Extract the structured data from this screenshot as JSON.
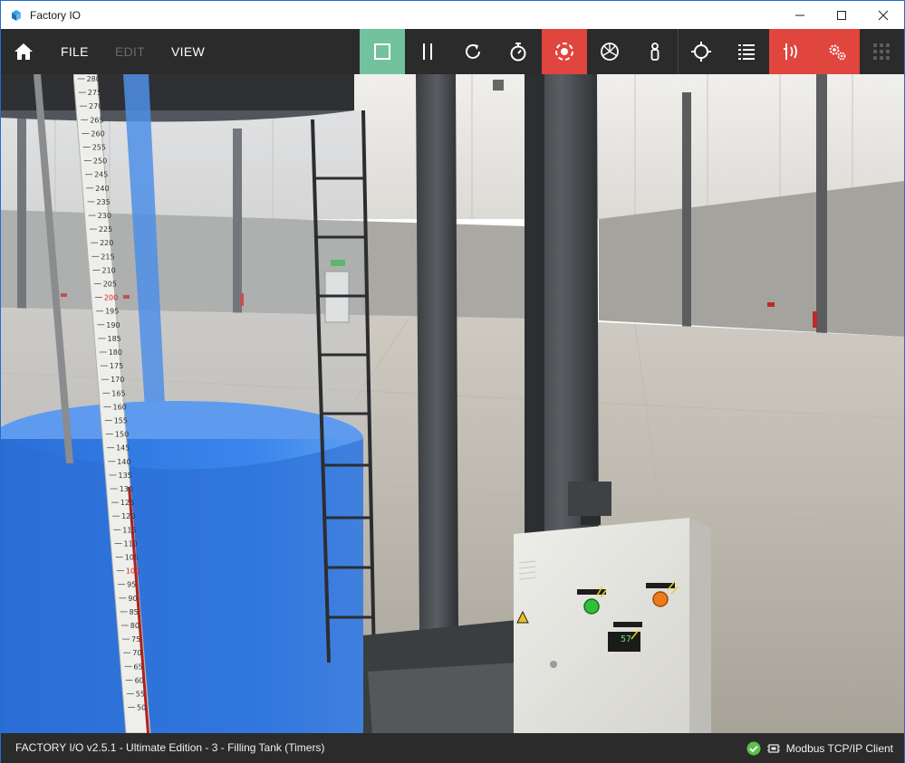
{
  "window": {
    "title": "Factory IO"
  },
  "toolbar": {
    "menu": [
      {
        "label": "FILE",
        "enabled": true
      },
      {
        "label": "EDIT",
        "enabled": false
      },
      {
        "label": "VIEW",
        "enabled": true
      }
    ],
    "buttons": [
      {
        "name": "play-stop",
        "icon": "stop-square-icon",
        "active": true,
        "color": "#72c29d"
      },
      {
        "name": "pause",
        "icon": "pause-icon"
      },
      {
        "name": "reset",
        "icon": "reset-icon"
      },
      {
        "name": "timer",
        "icon": "stopwatch-icon"
      },
      {
        "name": "orbit-camera",
        "icon": "orbit-camera-icon",
        "active": true,
        "color": "#e0453e"
      },
      {
        "name": "fly-camera",
        "icon": "fly-camera-icon"
      },
      {
        "name": "first-person",
        "icon": "first-person-icon"
      },
      {
        "name": "crosshair",
        "icon": "crosshair-icon"
      },
      {
        "name": "list",
        "icon": "list-icon"
      },
      {
        "name": "drivers",
        "icon": "drivers-icon",
        "active": true,
        "color": "#e0453e"
      },
      {
        "name": "settings",
        "icon": "gears-icon",
        "active": true,
        "color": "#e0453e"
      },
      {
        "name": "palette",
        "icon": "grid-icon"
      }
    ]
  },
  "scene": {
    "level_scale": {
      "labels": [
        "280",
        "275",
        "270",
        "265",
        "260",
        "255",
        "250",
        "245",
        "240",
        "235",
        "230",
        "225",
        "220",
        "215",
        "210",
        "205",
        "200",
        "195",
        "190",
        "185",
        "180",
        "175",
        "170",
        "165",
        "160",
        "155",
        "150",
        "145",
        "140",
        "135",
        "130",
        "125",
        "120",
        "115",
        "110",
        "105",
        "100",
        "95",
        "90",
        "85",
        "80",
        "75",
        "70",
        "65",
        "60",
        "55",
        "50"
      ],
      "red_labels": [
        "200",
        "100"
      ]
    },
    "panel_display_value": "57"
  },
  "statusbar": {
    "text": "FACTORY I/O v2.5.1 - Ultimate Edition - 3 - Filling Tank (Timers)",
    "connection": "Modbus TCP/IP Client",
    "connection_ok": true
  },
  "colors": {
    "accent_green": "#72c29d",
    "accent_red": "#e0453e",
    "toolbar_bg": "#2b2b2b",
    "water": "#2f7fe0"
  }
}
